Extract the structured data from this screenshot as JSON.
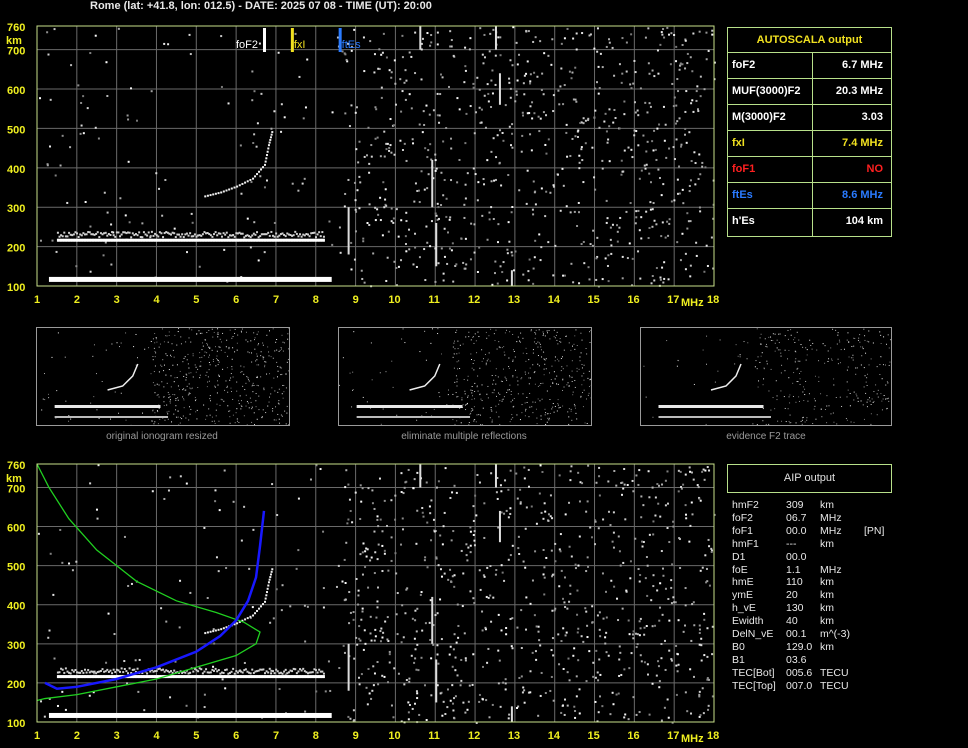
{
  "header": "Rome (lat: +41.8, lon: 012.5) - DATE: 2025 07 08 - TIME (UT): 20:00",
  "colors": {
    "grid": "#6a6a6a",
    "frame": "#c8e08a",
    "axis_label": "#f0f020",
    "foF2": "#ffffff",
    "fxI": "#f0e020",
    "ftEs": "#2a7bff",
    "foF1": "#ff2020",
    "green_curve": "#20d020",
    "blue_curve": "#1818ff"
  },
  "autoscala": {
    "title": "AUTOSCALA output",
    "rows": [
      {
        "label": "foF2",
        "value": "6.7 MHz",
        "color": "#ffffff"
      },
      {
        "label": "MUF(3000)F2",
        "value": "20.3 MHz",
        "color": "#ffffff"
      },
      {
        "label": "M(3000)F2",
        "value": "3.03",
        "color": "#ffffff"
      },
      {
        "label": "fxI",
        "value": "7.4 MHz",
        "color": "#f0e020"
      },
      {
        "label": "foF1",
        "value": "NO",
        "color": "#ff2020"
      },
      {
        "label": "ftEs",
        "value": "8.6 MHz",
        "color": "#2a7bff"
      },
      {
        "label": "h'Es",
        "value": "104     km",
        "color": "#ffffff"
      }
    ]
  },
  "aip": {
    "title": "AIP output",
    "rows": [
      [
        "hmF2",
        "309",
        "km",
        ""
      ],
      [
        "foF2",
        "06.7",
        "MHz",
        ""
      ],
      [
        "foF1",
        "00.0",
        "MHz",
        "[PN]"
      ],
      [
        "hmF1",
        "---",
        "km",
        ""
      ],
      [
        "D1",
        "00.0",
        "",
        ""
      ],
      [
        "foE",
        "1.1",
        "MHz",
        ""
      ],
      [
        "hmE",
        "110",
        "km",
        ""
      ],
      [
        "ymE",
        "20",
        "km",
        ""
      ],
      [
        "h_vE",
        "130",
        "km",
        ""
      ],
      [
        "Ewidth",
        "40",
        "km",
        ""
      ],
      [
        "DelN_vE",
        "00.1",
        "m^(-3)",
        ""
      ],
      [
        "B0",
        "129.0",
        "km",
        ""
      ],
      [
        "B1",
        "03.6",
        "",
        ""
      ],
      [
        "TEC[Bot]",
        "005.6",
        "TECU",
        ""
      ],
      [
        "TEC[Top]",
        "007.0",
        "TECU",
        ""
      ]
    ]
  },
  "thumbs": [
    "original ionogram resized",
    "eliminate multiple reflections",
    "evidence F2 trace"
  ],
  "chart_data": [
    {
      "type": "scatter",
      "x_unit": "MHz",
      "y_unit": "km",
      "xlim": [
        1,
        18
      ],
      "ylim": [
        100,
        760
      ],
      "xticks": [
        1,
        2,
        3,
        4,
        5,
        6,
        7,
        8,
        9,
        10,
        11,
        12,
        13,
        14,
        15,
        16,
        17,
        18
      ],
      "yticks": [
        100,
        200,
        300,
        400,
        500,
        600,
        700,
        760
      ],
      "markers": [
        {
          "label": "foF2",
          "x": 6.7,
          "color": "#ffffff"
        },
        {
          "label": "fxI",
          "x": 7.4,
          "color": "#f0e020"
        },
        {
          "label": "ftEs",
          "x": 8.6,
          "color": "#2a7bff"
        }
      ],
      "traces": {
        "F_layer": [
          [
            5.2,
            330
          ],
          [
            5.6,
            340
          ],
          [
            6.0,
            355
          ],
          [
            6.4,
            375
          ],
          [
            6.7,
            410
          ],
          [
            6.8,
            460
          ],
          [
            6.9,
            500
          ]
        ],
        "Es_band": {
          "x": [
            1.5,
            8.2
          ],
          "y": 220
        },
        "E_band": {
          "x": [
            1.3,
            8.4
          ],
          "y": 118
        }
      }
    },
    {
      "type": "line",
      "x_unit": "MHz",
      "y_unit": "km",
      "xlim": [
        1,
        18
      ],
      "ylim": [
        100,
        760
      ],
      "xticks": [
        1,
        2,
        3,
        4,
        5,
        6,
        7,
        8,
        9,
        10,
        11,
        12,
        13,
        14,
        15,
        16,
        17,
        18
      ],
      "yticks": [
        100,
        200,
        300,
        400,
        500,
        600,
        700,
        760
      ],
      "series": [
        {
          "color": "#20d020",
          "x": [
            1.0,
            1.3,
            1.8,
            2.5,
            3.5,
            4.5,
            5.5,
            6.2,
            6.6,
            6.5,
            6.0,
            5.0,
            4.0,
            3.0,
            2.0,
            1.2,
            1.0
          ],
          "y": [
            760,
            700,
            620,
            540,
            460,
            410,
            380,
            355,
            330,
            300,
            270,
            240,
            210,
            190,
            170,
            160,
            155
          ]
        },
        {
          "color": "#1818ff",
          "x": [
            1.2,
            1.5,
            2.0,
            3.0,
            4.0,
            5.0,
            5.6,
            6.0,
            6.3,
            6.5,
            6.6,
            6.7
          ],
          "y": [
            200,
            185,
            190,
            210,
            240,
            280,
            320,
            360,
            410,
            470,
            550,
            640
          ]
        }
      ],
      "traces": {
        "F_layer": [
          [
            5.2,
            330
          ],
          [
            5.6,
            340
          ],
          [
            6.0,
            355
          ],
          [
            6.4,
            375
          ],
          [
            6.7,
            410
          ],
          [
            6.8,
            460
          ],
          [
            6.9,
            500
          ]
        ],
        "Es_band": {
          "x": [
            1.5,
            8.2
          ],
          "y": 220
        },
        "E_band": {
          "x": [
            1.3,
            8.4
          ],
          "y": 118
        }
      }
    }
  ]
}
